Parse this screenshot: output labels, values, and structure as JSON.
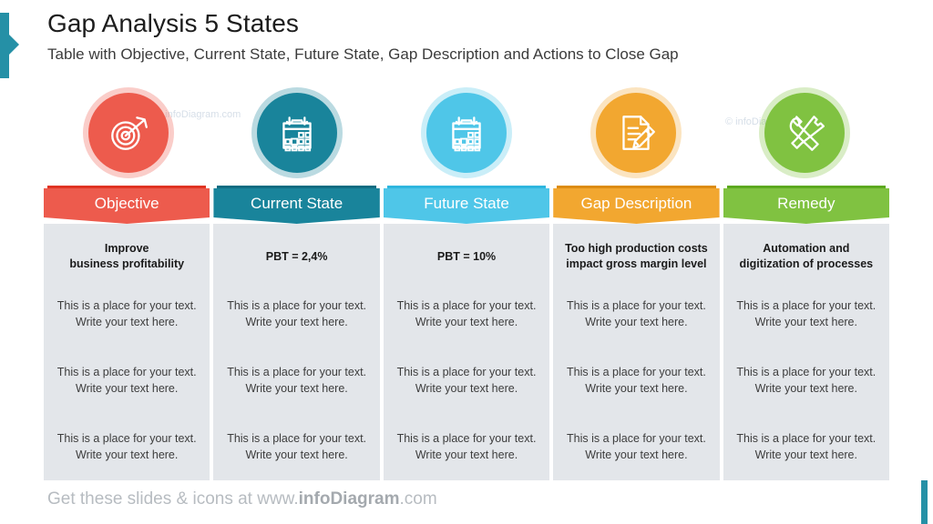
{
  "header": {
    "title": "Gap Analysis 5 States",
    "subtitle": "Table with Objective, Current State, Future State, Gap Description and Actions to Close Gap"
  },
  "colors": {
    "accent_teal": "#2590a6",
    "objective_red": "#ed5b4d",
    "objective_red_dark": "#e03322",
    "current_teal": "#19849b",
    "current_teal_dark": "#0f6c82",
    "future_blue": "#4fc6e8",
    "future_blue_dark": "#2eb6de",
    "gap_orange": "#f2a730",
    "gap_orange_dark": "#dc8c12",
    "remedy_green": "#80c241",
    "remedy_green_dark": "#5ca81f",
    "panel_gray": "#e3e6ea",
    "footer_gray": "#b7bcc1"
  },
  "watermarks": [
    "© infoDiagram.com",
    "© infoDiagram.com"
  ],
  "columns": [
    {
      "id": "objective",
      "header": "Objective",
      "icon": "target-arrow-icon",
      "color": "#ed5b4d",
      "color_dark": "#e03322",
      "highlight": "Improve\nbusiness profitability",
      "rows": [
        "This is a place for your text.\nWrite your text here.",
        "This is a place for your text.\nWrite your text here.",
        "This is a place for your text.\nWrite your text here."
      ]
    },
    {
      "id": "current-state",
      "header": "Current State",
      "icon": "calendar-icon",
      "color": "#19849b",
      "color_dark": "#0f6c82",
      "highlight": "PBT = 2,4%",
      "rows": [
        "This is a place for your text.\nWrite your text here.",
        "This is a place for your text.\nWrite your text here.",
        "This is a place for your text.\nWrite your text here."
      ]
    },
    {
      "id": "future-state",
      "header": "Future State",
      "icon": "calendar-icon",
      "color": "#4fc6e8",
      "color_dark": "#2eb6de",
      "highlight": "PBT = 10%",
      "rows": [
        "This is a place for your text.\nWrite your text here.",
        "This is a place for your text.\nWrite your text here.",
        "This is a place for your text.\nWrite your text here."
      ]
    },
    {
      "id": "gap-description",
      "header": "Gap Description",
      "icon": "document-pencil-icon",
      "color": "#f2a730",
      "color_dark": "#dc8c12",
      "highlight": "Too high production costs\nimpact gross margin level",
      "rows": [
        "This is a place for your text.\nWrite your text here.",
        "This is a place for your text.\nWrite your text here.",
        "This is a place for your text.\nWrite your text here."
      ]
    },
    {
      "id": "remedy",
      "header": "Remedy",
      "icon": "tools-icon",
      "color": "#80c241",
      "color_dark": "#5ca81f",
      "highlight": "Automation and\ndigitization of processes",
      "rows": [
        "This is a place for your text.\nWrite your text here.",
        "This is a place for your text.\nWrite your text here.",
        "This is a place for your text.\nWrite your text here."
      ]
    }
  ],
  "footer": {
    "prefix": "Get these slides & icons at www.",
    "brand": "infoDiagram",
    "suffix": ".com"
  }
}
